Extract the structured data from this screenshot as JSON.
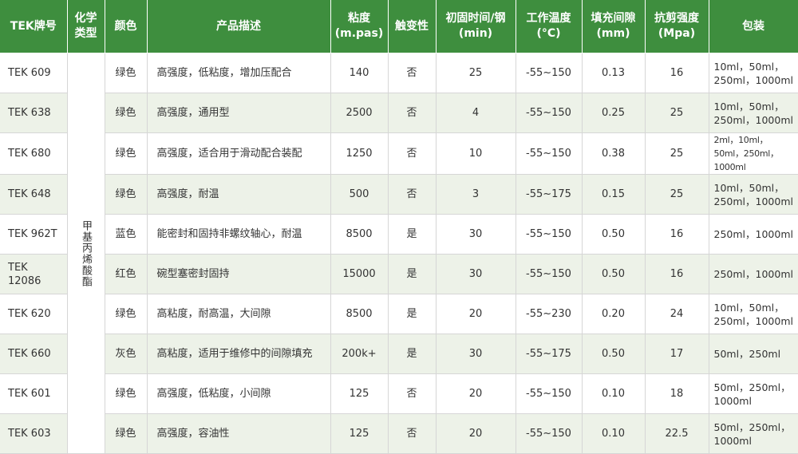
{
  "headers": {
    "brand": "TEK牌号",
    "chem_type": "化学类型",
    "color": "颜色",
    "description": "产品描述",
    "viscosity": "粘度(m.pas)",
    "thixotropic": "触变性",
    "cure_time": "初固时间/钢(min)",
    "work_temp": "工作温度(°C)",
    "gap": "填充间隙(mm)",
    "shear": "抗剪强度(Mpa)",
    "package": "包装"
  },
  "chemical_type": "甲基丙烯酸酯",
  "rows": [
    {
      "brand": "TEK 609",
      "color": "绿色",
      "description": "高强度，低粘度，增加压配合",
      "viscosity": "140",
      "thixotropic": "否",
      "cure_time": "25",
      "work_temp": "-55~150",
      "gap": "0.13",
      "shear": "16",
      "package": "10ml，50ml，250ml，1000ml"
    },
    {
      "brand": "TEK 638",
      "color": "绿色",
      "description": "高强度，通用型",
      "viscosity": "2500",
      "thixotropic": "否",
      "cure_time": "4",
      "work_temp": "-55~150",
      "gap": "0.25",
      "shear": "25",
      "package": "10ml，50ml，250ml，1000ml"
    },
    {
      "brand": "TEK 680",
      "color": "绿色",
      "description": "高强度，适合用于滑动配合装配",
      "viscosity": "1250",
      "thixotropic": "否",
      "cure_time": "10",
      "work_temp": "-55~150",
      "gap": "0.38",
      "shear": "25",
      "package": "2ml，10ml，50ml，250ml，1000ml"
    },
    {
      "brand": "TEK 648",
      "color": "绿色",
      "description": "高强度，耐温",
      "viscosity": "500",
      "thixotropic": "否",
      "cure_time": "3",
      "work_temp": "-55~175",
      "gap": "0.15",
      "shear": "25",
      "package": "10ml，50ml，250ml，1000ml"
    },
    {
      "brand": "TEK 962T",
      "color": "蓝色",
      "description": "能密封和固持非螺纹轴心，耐温",
      "viscosity": "8500",
      "thixotropic": "是",
      "cure_time": "30",
      "work_temp": "-55~150",
      "gap": "0.50",
      "shear": "16",
      "package": "250ml，1000ml"
    },
    {
      "brand": "TEK 12086",
      "color": "红色",
      "description": "碗型塞密封固持",
      "viscosity": "15000",
      "thixotropic": "是",
      "cure_time": "30",
      "work_temp": "-55~150",
      "gap": "0.50",
      "shear": "16",
      "package": "250ml，1000ml"
    },
    {
      "brand": "TEK 620",
      "color": "绿色",
      "description": "高粘度，耐高温，大间隙",
      "viscosity": "8500",
      "thixotropic": "是",
      "cure_time": "20",
      "work_temp": "-55~230",
      "gap": "0.20",
      "shear": "24",
      "package": "10ml，50ml，250ml，1000ml"
    },
    {
      "brand": "TEK 660",
      "color": "灰色",
      "description": "高粘度，适用于维修中的间隙填充",
      "viscosity": "200k+",
      "thixotropic": "是",
      "cure_time": "30",
      "work_temp": "-55~175",
      "gap": "0.50",
      "shear": "17",
      "package": "50ml，250ml"
    },
    {
      "brand": "TEK 601",
      "color": "绿色",
      "description": "高强度，低粘度，小间隙",
      "viscosity": "125",
      "thixotropic": "否",
      "cure_time": "20",
      "work_temp": "-55~150",
      "gap": "0.10",
      "shear": "18",
      "package": "50ml，250ml，1000ml"
    },
    {
      "brand": "TEK 603",
      "color": "绿色",
      "description": "高强度，容油性",
      "viscosity": "125",
      "thixotropic": "否",
      "cure_time": "20",
      "work_temp": "-55~150",
      "gap": "0.10",
      "shear": "22.5",
      "package": "50ml，250ml，1000ml"
    }
  ]
}
